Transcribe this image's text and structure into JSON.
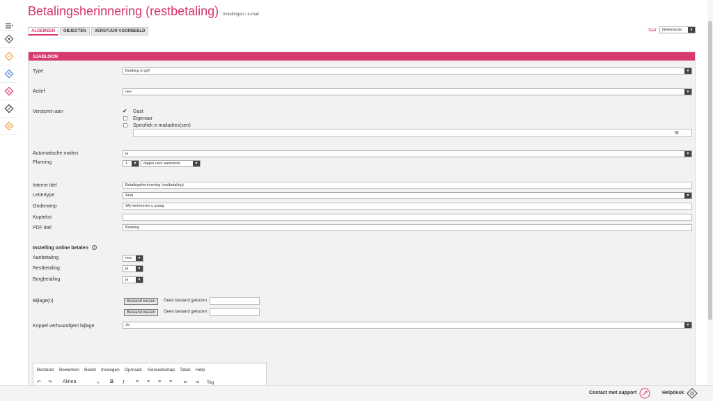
{
  "header": {
    "title": "Betalingsherinnering (restbetaling)",
    "breadcrumb": "instellingen › e-mail"
  },
  "tabs": [
    "ALGEMEEN",
    "OBJECTEN",
    "VERSTUUR VOORBEELD"
  ],
  "language": {
    "label": "Taal:",
    "value": "Nederlands"
  },
  "sidebar": {
    "icons": [
      "menu-icon",
      "home-icon",
      "shop-icon",
      "transfer-icon",
      "report-icon",
      "ticket-icon",
      "settings-icon"
    ]
  },
  "panel": {
    "title": "SJABLOON"
  },
  "form": {
    "type": {
      "label": "Type",
      "value": "Boeking in pdf"
    },
    "actief": {
      "label": "Actief",
      "value": "nee"
    },
    "versturen": {
      "label": "Versturen aan",
      "options": [
        {
          "label": "Gast",
          "checked": true
        },
        {
          "label": "Eigenaar",
          "checked": false
        },
        {
          "label": "Specifiek e-mailadres(sen)",
          "checked": false
        }
      ]
    },
    "auto": {
      "label": "Automatische mailen",
      "value": "ja"
    },
    "planning": {
      "label": "Planning",
      "num": "1",
      "unit": "dagen voor aankomst"
    },
    "interne_titel": {
      "label": "Interne titel",
      "value": "Betalingsherinnering (restbetaling)"
    },
    "lettertype": {
      "label": "Lettertype",
      "value": "Arial"
    },
    "onderwerp": {
      "label": "Onderwerp",
      "value": "Wij herinneren u graag"
    },
    "koptekst": {
      "label": "Koptekst",
      "value": ""
    },
    "pdf_titel": {
      "label": "PDF titel",
      "value": "Boeking"
    },
    "online": {
      "heading": "Instelling online betalen",
      "aanbetaling": {
        "label": "Aanbetaling",
        "value": "nee"
      },
      "restbetaling": {
        "label": "Restbetaling",
        "value": "ja"
      },
      "borgbetaling": {
        "label": "Borgbetaling",
        "value": "ja"
      }
    },
    "bijlage": {
      "label": "Bijlage(n)",
      "button": "Bestand kiezen",
      "none": "Geen bestand gekozen"
    },
    "koppel": {
      "label": "Koppel verhuurobject bijlage",
      "value": "Ja"
    }
  },
  "editor": {
    "menu": [
      "Bestand",
      "Bewerken",
      "Beeld",
      "Invoegen",
      "Opmaak",
      "Gereedschap",
      "Tabel",
      "Help"
    ],
    "format": "Alinea",
    "tag": "Tag"
  },
  "footer": {
    "support": "Contact met support",
    "helpdesk": "Helpdesk"
  }
}
